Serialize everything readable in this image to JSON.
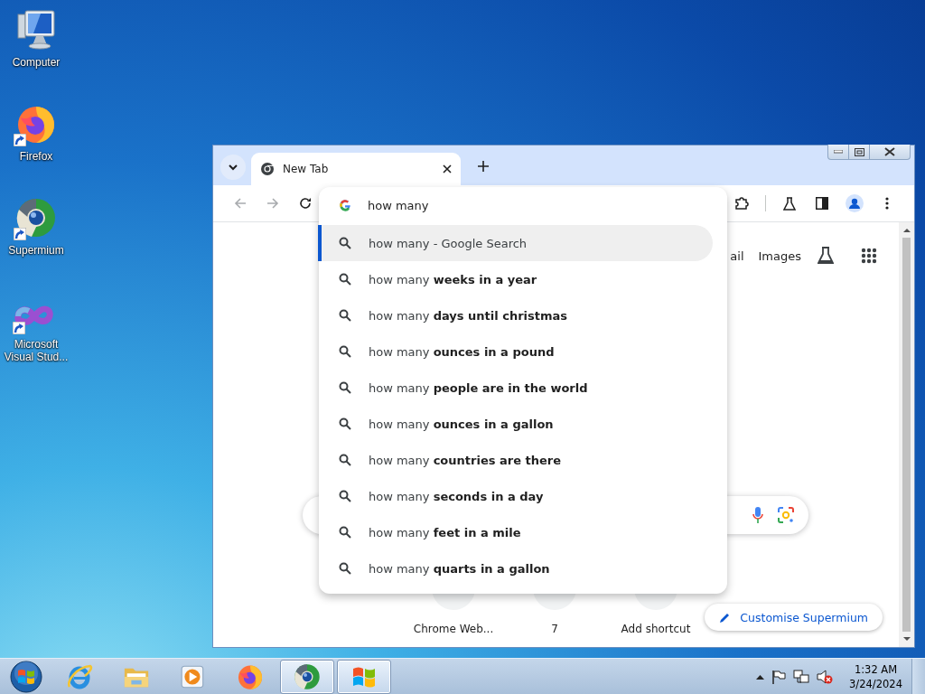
{
  "desktop_icons": [
    {
      "kind": "computer",
      "label": "Computer"
    },
    {
      "kind": "firefox",
      "label": "Firefox"
    },
    {
      "kind": "supermium",
      "label": "Supermium"
    },
    {
      "kind": "visualstudio",
      "label": "Microsoft Visual Stud..."
    }
  ],
  "browser": {
    "tabs": [
      {
        "title": "New Tab",
        "selected": true
      }
    ],
    "omnibox": {
      "value": "how many"
    },
    "suggestions": [
      {
        "text": "how many - Google Search",
        "selected": true
      },
      {
        "text": "how many **weeks in a year**",
        "selected": false
      },
      {
        "text": "how many **days until christmas**",
        "selected": false
      },
      {
        "text": "how many **ounces in a pound**",
        "selected": false
      },
      {
        "text": "how many **people are in the world**",
        "selected": false
      },
      {
        "text": "how many **ounces in a gallon**",
        "selected": false
      },
      {
        "text": "how many **countries are there**",
        "selected": false
      },
      {
        "text": "how many **seconds in a day**",
        "selected": false
      },
      {
        "text": "how many **feet in a mile**",
        "selected": false
      },
      {
        "text": "how many **quarts in a gallon**",
        "selected": false
      }
    ],
    "page": {
      "links": [
        "ail",
        "Images"
      ],
      "shortcuts": [
        "Chrome Web...",
        "7",
        "Add shortcut"
      ],
      "customise_button": "Customise Supermium"
    }
  },
  "taskbar": {
    "apps": [
      {
        "kind": "ie",
        "selected": false
      },
      {
        "kind": "explorer",
        "selected": false
      },
      {
        "kind": "media",
        "selected": false
      },
      {
        "kind": "firefox",
        "selected": false
      },
      {
        "kind": "supermium",
        "selected": true
      },
      {
        "kind": "windows",
        "selected": true
      }
    ],
    "clock": {
      "time": "1:32 AM",
      "date": "3/24/2024"
    }
  }
}
